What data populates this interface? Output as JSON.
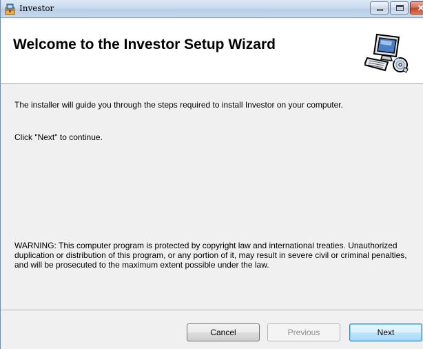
{
  "window": {
    "title": "Investor",
    "icons": {
      "app": "installer-package-icon",
      "minimize": "minimize-icon",
      "maximize": "maximize-icon",
      "close": "close-icon"
    },
    "close_glyph": "✕"
  },
  "banner": {
    "title": "Welcome to the Investor Setup Wizard",
    "graphic": "computer-setup-icon"
  },
  "body": {
    "intro": "The installer will guide you through the steps required to install Investor on your computer.",
    "instruction": "Click \"Next\" to continue.",
    "warning": "WARNING: This computer program is protected by copyright law and international treaties. Unauthorized duplication or distribution of this program, or any portion of it, may result in severe civil or criminal penalties, and will be prosecuted to the maximum extent possible under the law."
  },
  "buttons": {
    "cancel": "Cancel",
    "previous": "Previous",
    "next": "Next"
  },
  "colors": {
    "title_bar": "#c9dbee",
    "dialog_bg": "#f0f0f0",
    "banner_bg": "#ffffff",
    "next_focus": "#3c7fb1"
  }
}
